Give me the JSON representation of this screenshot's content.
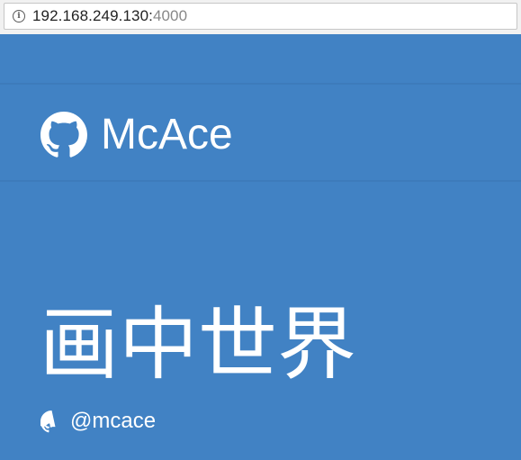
{
  "browser": {
    "url_host": "192.168.249.130:",
    "url_port": "4000",
    "info_icon": "info-icon"
  },
  "header": {
    "brand_icon": "github-icon",
    "brand_name": "McAce"
  },
  "hero": {
    "title": "画中世界",
    "handle_icon": "github-icon",
    "handle": "@mcace"
  },
  "colors": {
    "background": "#4182c4",
    "text": "#ffffff"
  }
}
